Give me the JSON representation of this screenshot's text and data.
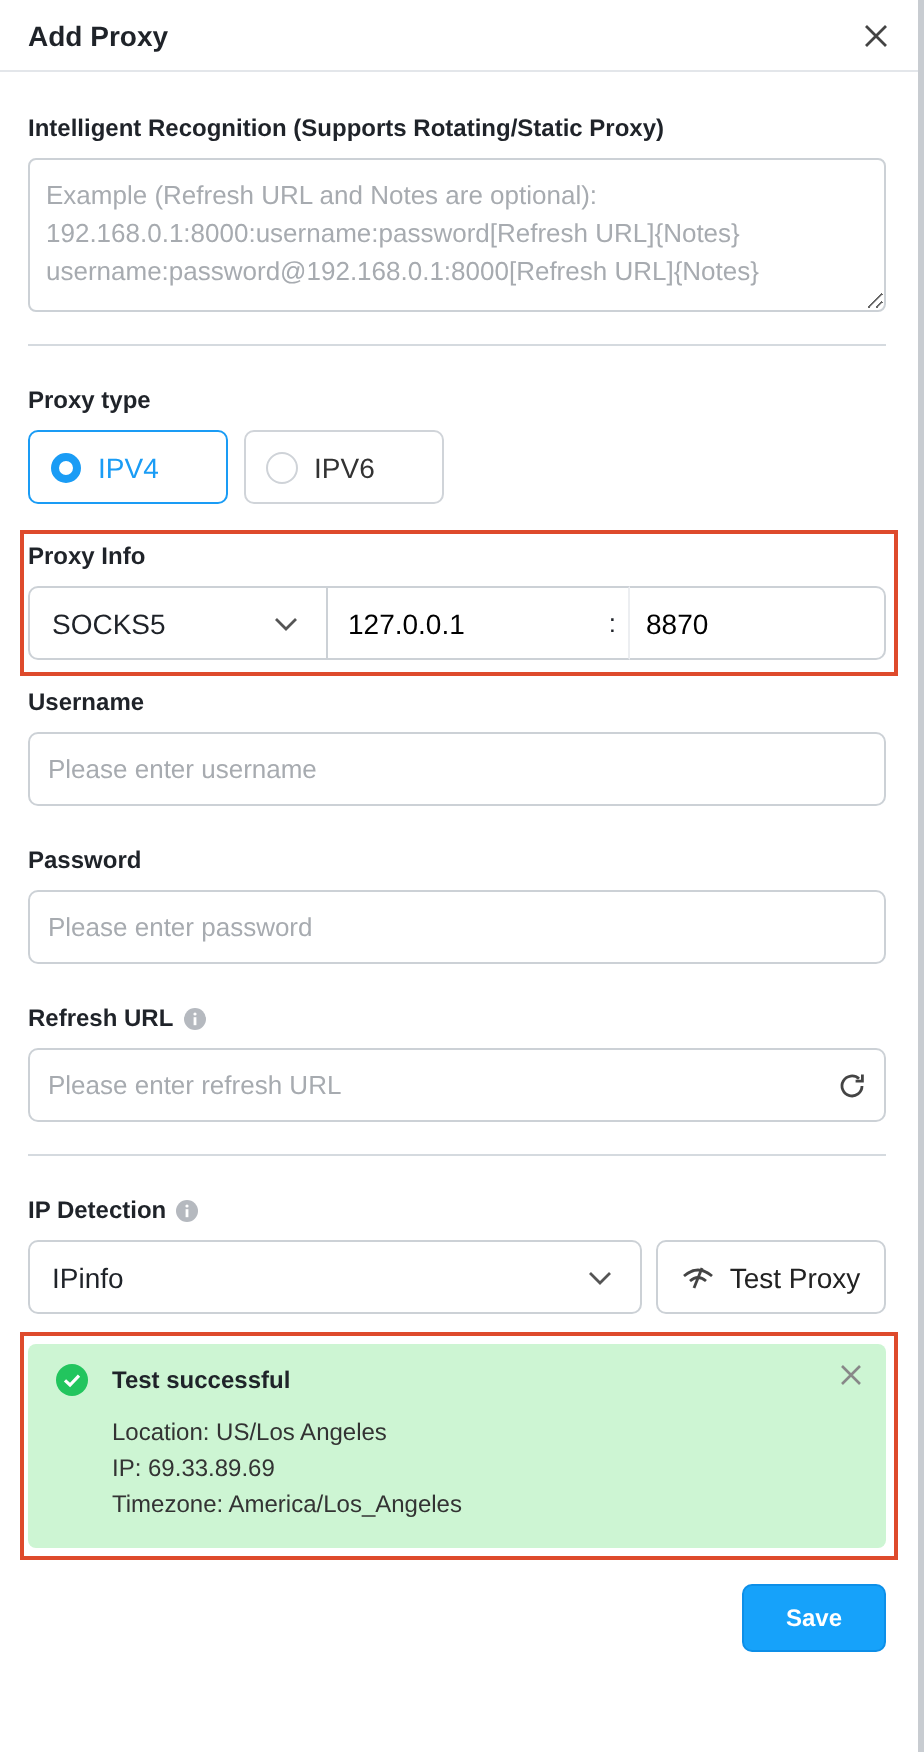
{
  "dialog": {
    "title": "Add Proxy"
  },
  "recognition": {
    "label": "Intelligent Recognition (Supports Rotating/Static Proxy)",
    "placeholder": "Example (Refresh URL and Notes are optional):\n192.168.0.1:8000:username:password[Refresh URL]{Notes}\nusername:password@192.168.0.1:8000[Refresh URL]{Notes}"
  },
  "proxy_type": {
    "label": "Proxy type",
    "options": [
      {
        "label": "IPV4",
        "selected": true
      },
      {
        "label": "IPV6",
        "selected": false
      }
    ]
  },
  "proxy_info": {
    "label": "Proxy Info",
    "highlighted": true,
    "protocol": "SOCKS5",
    "host": "127.0.0.1",
    "separator": ":",
    "port": "8870"
  },
  "username": {
    "label": "Username",
    "placeholder": "Please enter username"
  },
  "password": {
    "label": "Password",
    "placeholder": "Please enter password"
  },
  "refresh_url": {
    "label": "Refresh URL",
    "placeholder": "Please enter refresh URL"
  },
  "ip_detection": {
    "label": "IP Detection",
    "service": "IPinfo",
    "test_button": "Test Proxy"
  },
  "result": {
    "highlighted": true,
    "title": "Test successful",
    "lines": [
      "Location: US/Los Angeles",
      "IP: 69.33.89.69",
      "Timezone: America/Los_Angeles"
    ]
  },
  "save_button": "Save"
}
